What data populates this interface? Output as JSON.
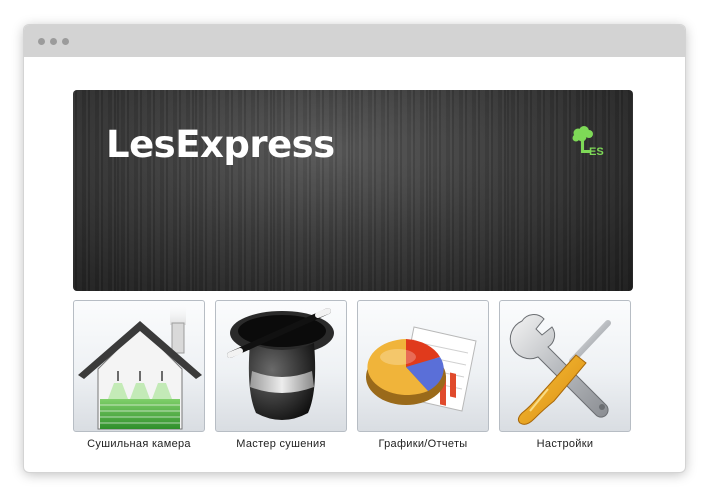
{
  "app": {
    "title": "LesExpress",
    "logo_text": "ES"
  },
  "tiles": [
    {
      "label": "Сушильная камера",
      "icon": "drying-chamber-icon"
    },
    {
      "label": "Мастер сушения",
      "icon": "magic-hat-icon"
    },
    {
      "label": "Графики/Отчеты",
      "icon": "pie-chart-icon"
    },
    {
      "label": "Настройки",
      "icon": "wrench-screwdriver-icon"
    }
  ],
  "colors": {
    "banner": "#2e2e2e",
    "logo": "#7ed957",
    "titlebar": "#d3d3d3"
  }
}
